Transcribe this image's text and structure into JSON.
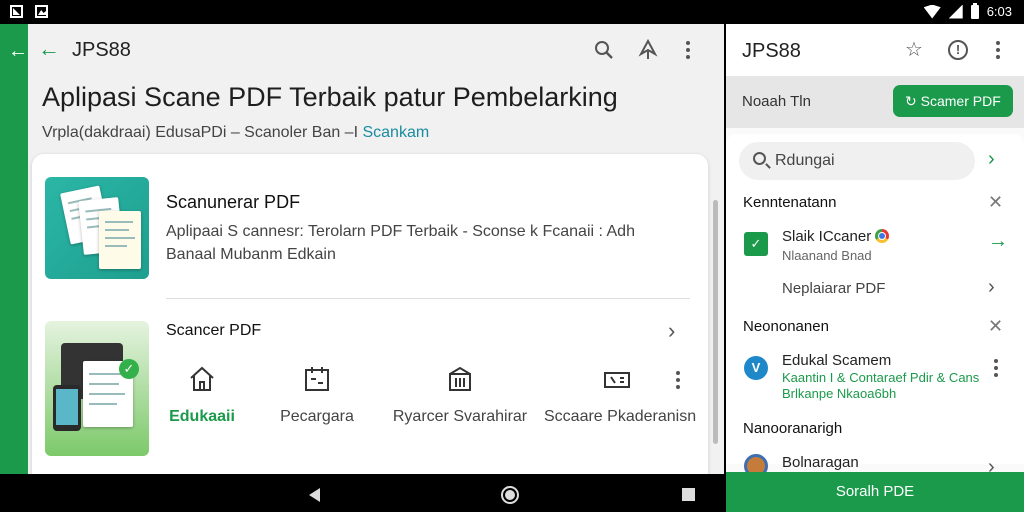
{
  "status_bar": {
    "time": "6:03"
  },
  "main": {
    "topbar_title": "JPS88",
    "headline": "Aplipasi Scane PDF Terbaik patur Pembelarking",
    "subline_prefix": "Vrpla(dakdraai) EdusaPDi – Scanoler Ban –I",
    "subline_accent": "Scankam",
    "card1": {
      "title": "Scanunerar PDF",
      "desc": "Aplipaai S cannesr: Terolarn PDF Terbaik - Sconse k Fcanaii : Adh Banaal Mubanm Edkain"
    },
    "card2": {
      "title": "Scancer PDF",
      "features": [
        {
          "label": "Edukaaii",
          "icon": "home-icon"
        },
        {
          "label": "Pecargara",
          "icon": "calendar-icon"
        },
        {
          "label": "Ryarcer Svarahirar",
          "icon": "library-icon"
        },
        {
          "label": "Sccaare Pkaderanisn",
          "icon": "scanner-icon"
        }
      ]
    }
  },
  "right": {
    "topbar_title": "JPS88",
    "band_label": "Noaah Tln",
    "band_button": "Scamer PDF",
    "search_placeholder": "Rdungai",
    "section1": {
      "title": "Kenntenatann",
      "item_title": "Slaik ICcaner",
      "item_sub": "Nlaanand Bnad",
      "link": "Neplaiarar PDF"
    },
    "section2": {
      "title": "Neononanen",
      "item_title": "Edukal Scamem",
      "item_sub1": "Kaantin I & Contaraef Pdir & Cans",
      "item_sub2": "Brlkanpe Nkaoa6bh"
    },
    "section3": {
      "title": "Nanooranarigh",
      "item_title": "Bolnaragan"
    },
    "bottom_button": "Soralh PDE"
  },
  "colors": {
    "brand_green": "#1a9a4a",
    "accent_teal": "#1a8ca0"
  }
}
